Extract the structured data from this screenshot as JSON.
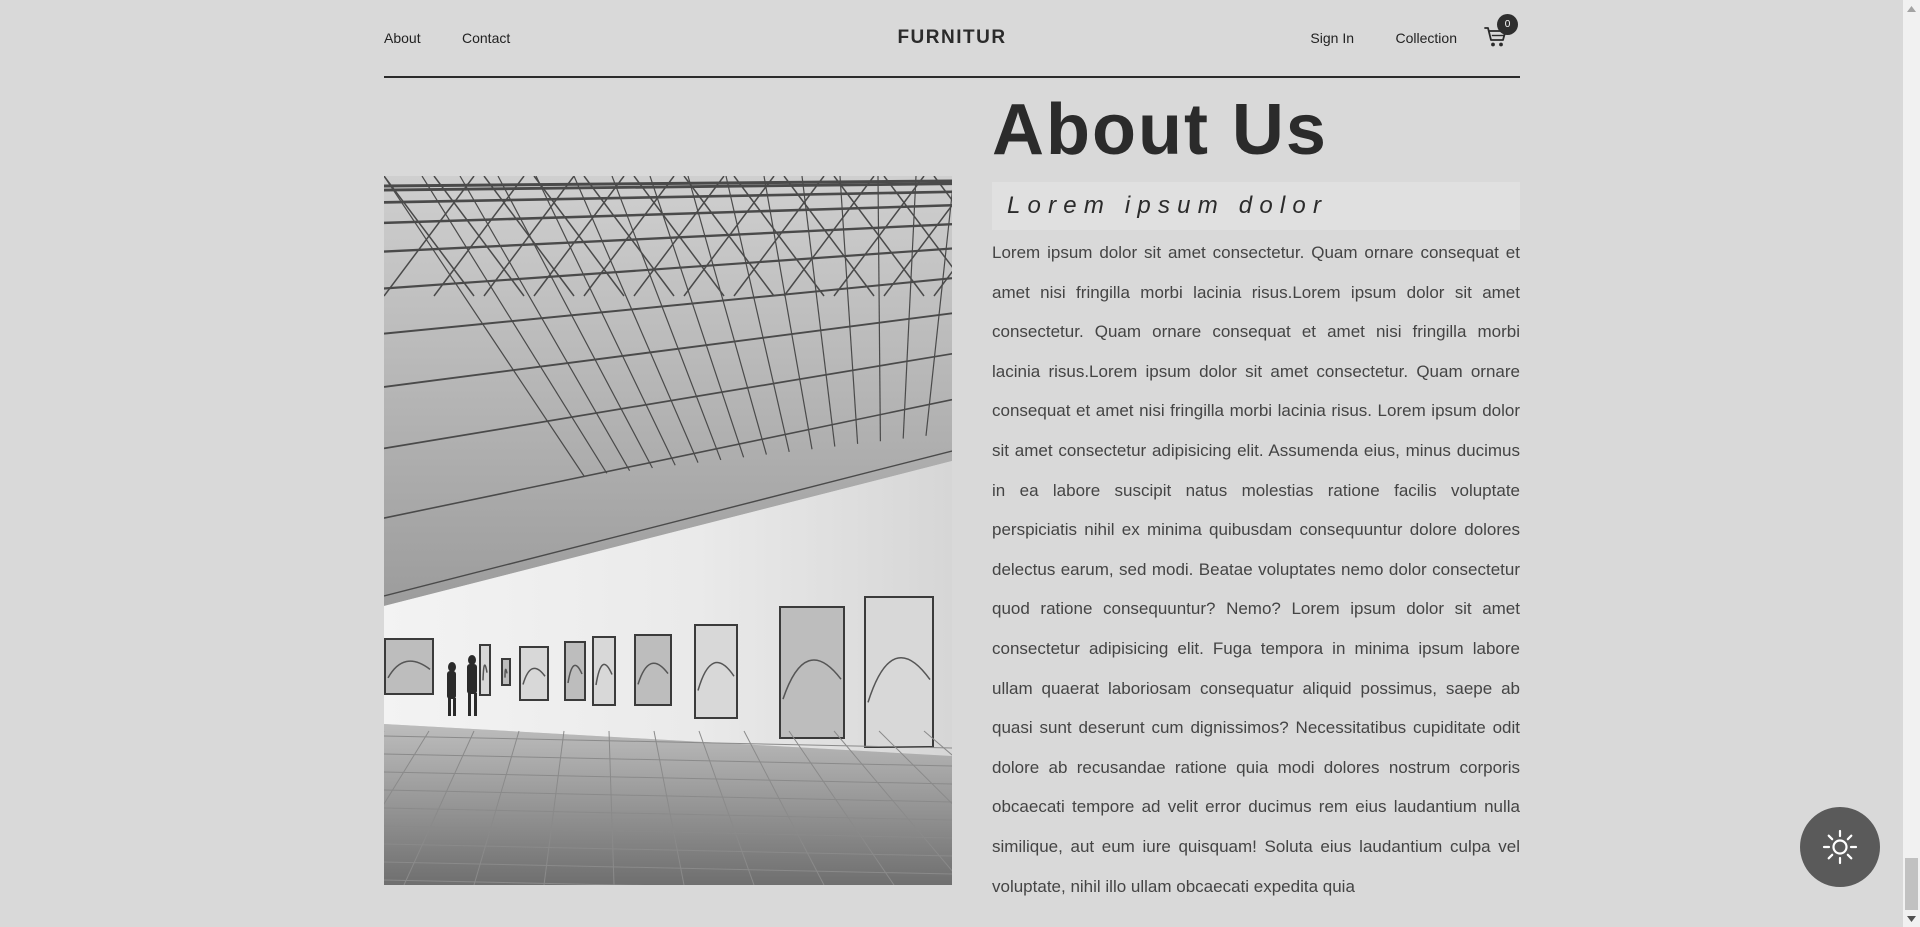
{
  "header": {
    "nav_left": {
      "about": "About",
      "contact": "Contact"
    },
    "brand": "FURNITUR",
    "nav_right": {
      "sign_in": "Sign In",
      "collection": "Collection"
    },
    "cart": {
      "icon": "cart-icon",
      "count": "0"
    }
  },
  "about": {
    "title": "About Us",
    "subtitle": "Lorem ipsum dolor",
    "body": "Lorem ipsum dolor sit amet consectetur. Quam ornare consequat et amet nisi fringilla morbi lacinia risus.Lorem ipsum dolor sit amet consectetur. Quam ornare consequat et amet nisi fringilla morbi lacinia risus.Lorem ipsum dolor sit amet consectetur. Quam ornare consequat et amet nisi fringilla morbi lacinia risus. Lorem ipsum dolor sit amet consectetur adipisicing elit. Assumenda eius, minus ducimus in ea labore suscipit natus molestias ratione facilis voluptate perspiciatis nihil ex minima quibusdam consequuntur dolore dolores delectus earum, sed modi. Beatae voluptates nemo dolor consectetur quod ratione consequuntur? Nemo? Lorem ipsum dolor sit amet consectetur adipisicing elit. Fuga tempora in minima ipsum labore ullam quaerat laboriosam consequatur aliquid possimus, saepe ab quasi sunt deserunt cum dignissimos? Necessitatibus cupiditate odit dolore ab recusandae ratione quia modi dolores nostrum corporis obcaecati tempore ad velit error ducimus rem eius laudantium nulla similique, aut eum iure quisquam! Soluta eius laudantium culpa vel voluptate, nihil illo ullam obcaecati expedita quia",
    "image": {
      "subject": "art gallery interior with steel roof trusses and framed paintings"
    }
  },
  "theme_toggle": {
    "icon": "sun-icon"
  },
  "colors": {
    "background": "#d9d9d9",
    "text": "#2b2b2b",
    "subtitle_bg": "#e0e0e0",
    "toggle_bg": "#5a5a5a",
    "badge_bg": "#2f2f2f"
  }
}
